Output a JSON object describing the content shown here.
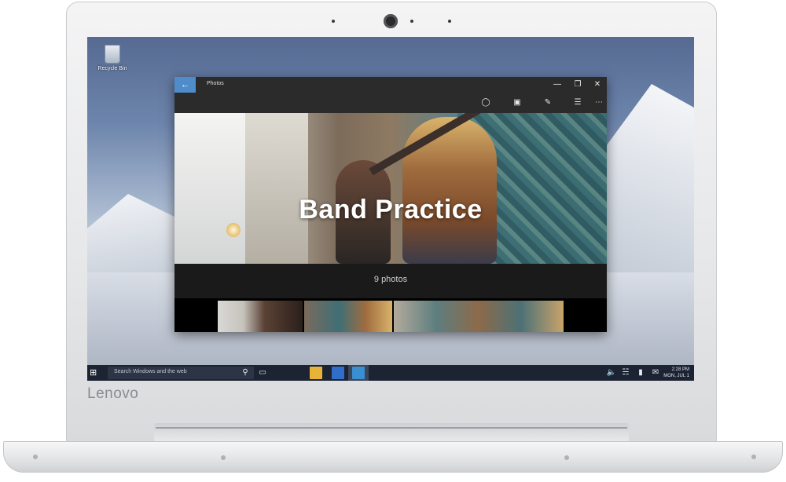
{
  "device": {
    "brand": "Lenovo"
  },
  "desktop": {
    "icons": [
      {
        "label": "Recycle Bin",
        "icon": "recycle-bin-icon"
      }
    ]
  },
  "app": {
    "title": "Photos",
    "window_controls": [
      "minimize",
      "restore",
      "close"
    ],
    "commands": [
      "share-icon",
      "slideshow-icon",
      "edit-icon",
      "select-icon",
      "more-icon"
    ],
    "album": {
      "title": "Band Practice",
      "count_label": "9 photos"
    }
  },
  "taskbar": {
    "search_placeholder": "Search Windows and the web",
    "clock_time": "2:28 PM",
    "clock_date": "MON, JUL 1"
  },
  "colors": {
    "accent": "#4f8cc9",
    "taskbar": "#1c2433",
    "app_bar": "#2b2b2b"
  }
}
